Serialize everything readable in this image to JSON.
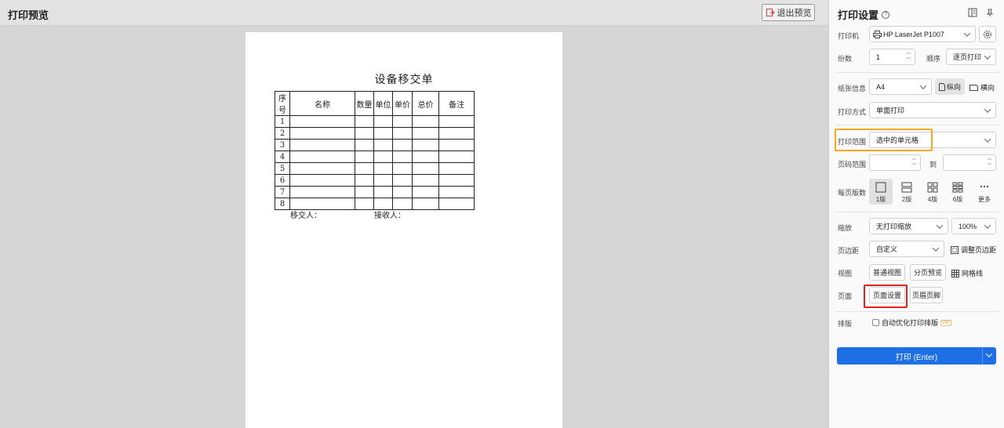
{
  "preview": {
    "title": "打印预览",
    "exit_label": "退出预览"
  },
  "document": {
    "title": "设备移交单",
    "headers": [
      "序号",
      "名称",
      "数量",
      "单位",
      "单价",
      "总价",
      "备注"
    ],
    "rows": [
      "1",
      "2",
      "3",
      "4",
      "5",
      "6",
      "7",
      "8"
    ],
    "handover_label": "移交人：",
    "receiver_label": "接收人："
  },
  "settings": {
    "title": "打印设置",
    "printer_label": "打印机",
    "printer_value": "HP LaserJet P1007",
    "copies_label": "份数",
    "copies_value": "1",
    "order_label": "顺序",
    "order_value": "逐页打印",
    "paper_label": "纸张信息",
    "paper_value": "A4",
    "portrait_label": "纵向",
    "landscape_label": "横向",
    "mode_label": "打印方式",
    "mode_value": "单面打印",
    "range_label": "打印范围",
    "range_value": "选中的单元格",
    "pages_label": "页码范围",
    "pages_to": "到",
    "per_page_label": "每页版数",
    "layouts": [
      "1版",
      "2版",
      "4版",
      "6版",
      "更多"
    ],
    "scale_label": "缩放",
    "scale_value": "无打印缩放",
    "zoom_value": "100%",
    "margin_label": "页边距",
    "margin_value": "自定义",
    "adjust_margin_label": "调整页边距",
    "view_label": "视图",
    "normal_view_label": "普通视图",
    "page_break_label": "分页预览",
    "gridlines_label": "网格线",
    "page_label": "页面",
    "page_setup_label": "页面设置",
    "header_footer_label": "页眉页脚",
    "layout_label": "排版",
    "auto_optimize_label": "自动优化打印排版",
    "vip_label": "VIP",
    "print_label": "打印 (Enter)"
  },
  "colors": {
    "accent": "#1e6fe6",
    "highlight_orange": "#f5a623",
    "highlight_red": "#e02020"
  }
}
